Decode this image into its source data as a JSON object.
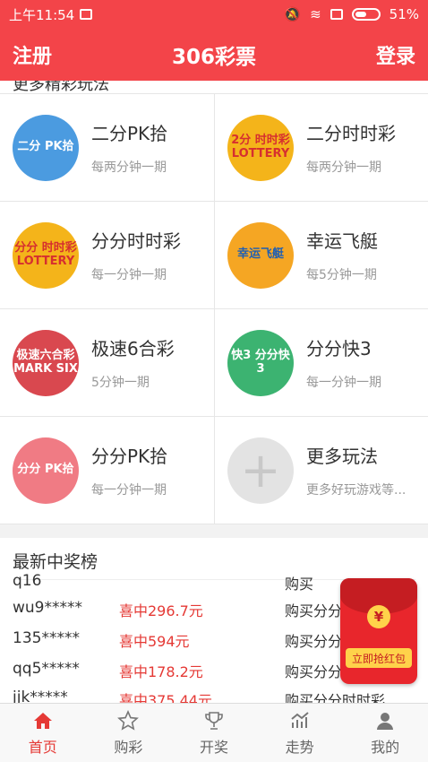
{
  "status_bar": {
    "time": "上午11:54",
    "battery": "51%"
  },
  "header": {
    "left": "注册",
    "title": "306彩票",
    "right": "登录"
  },
  "section_cut_text": "更多精彩玩法",
  "games": [
    {
      "name": "二分PK拾",
      "sub": "每两分钟一期",
      "icon_text": "二分 PK拾",
      "color": "#4b9be0"
    },
    {
      "name": "二分时时彩",
      "sub": "每两分钟一期",
      "icon_text": "2分 时时彩 LOTTERY",
      "color": "#f4b41a"
    },
    {
      "name": "分分时时彩",
      "sub": "每一分钟一期",
      "icon_text": "分分 时时彩 LOTTERY",
      "color": "#f4b41a"
    },
    {
      "name": "幸运飞艇",
      "sub": "每5分钟一期",
      "icon_text": "幸运飞艇",
      "color": "#f5a623"
    },
    {
      "name": "极速6合彩",
      "sub": "5分钟一期",
      "icon_text": "极速六合彩 MARK SIX",
      "color": "#d9484f"
    },
    {
      "name": "分分快3",
      "sub": "每一分钟一期",
      "icon_text": "快3 分分快3",
      "color": "#3cb371"
    },
    {
      "name": "分分PK拾",
      "sub": "每一分钟一期",
      "icon_text": "分分 PK拾",
      "color": "#f07b84"
    },
    {
      "name": "更多玩法",
      "sub": "更多好玩游戏等...",
      "icon_text": "+",
      "color": "#e3e3e3"
    }
  ],
  "winners": {
    "title": "最新中奖榜",
    "rows": [
      {
        "user": "q16",
        "win": "",
        "game": "购买"
      },
      {
        "user": "wu9*****",
        "win": "喜中296.7元",
        "game": "购买分分"
      },
      {
        "user": "135*****",
        "win": "喜中594元",
        "game": "购买分分"
      },
      {
        "user": "qq5*****",
        "win": "喜中178.2元",
        "game": "购买分分"
      },
      {
        "user": "jjk*****",
        "win": "喜中375.44元",
        "game": "购买分分时时彩"
      }
    ]
  },
  "red_packet": {
    "button": "立即抢红包",
    "coin": "¥"
  },
  "tabs": [
    {
      "label": "首页",
      "icon": "home-icon",
      "active": true
    },
    {
      "label": "购彩",
      "icon": "star-icon",
      "active": false
    },
    {
      "label": "开奖",
      "icon": "trophy-icon",
      "active": false
    },
    {
      "label": "走势",
      "icon": "trend-icon",
      "active": false
    },
    {
      "label": "我的",
      "icon": "user-icon",
      "active": false
    }
  ],
  "colors": {
    "primary": "#f34449",
    "win_red": "#e53935"
  }
}
